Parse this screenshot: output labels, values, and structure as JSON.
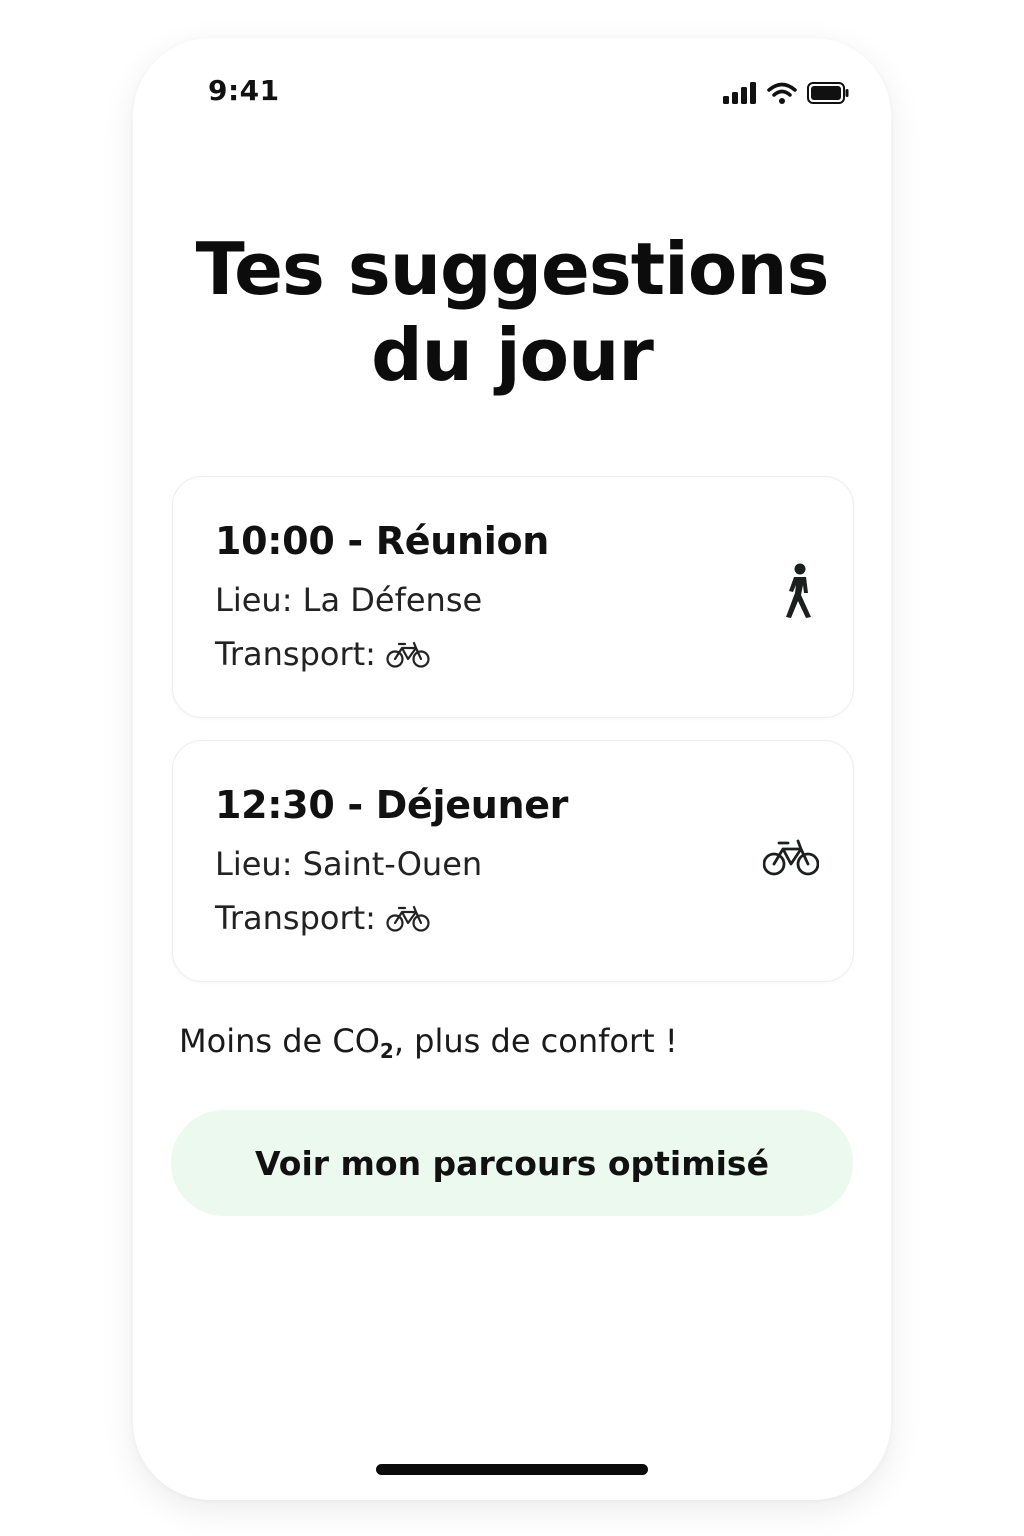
{
  "status_bar": {
    "time": "9:41",
    "icons": [
      "signal-icon",
      "wifi-icon",
      "battery-icon"
    ]
  },
  "header": {
    "title_line1": "Tes suggestions",
    "title_line2": "du jour"
  },
  "suggestions": [
    {
      "title": "10:00 - Réunion",
      "place": "Lieu: La Défense",
      "transport_label": "Transport:",
      "transport_icon": "bicycle-icon",
      "mode_icon": "walking-person-icon"
    },
    {
      "title": "12:30 - Déjeuner",
      "place": "Lieu: Saint-Ouen",
      "transport_label": "Transport:",
      "transport_icon": "bicycle-icon",
      "mode_icon": "bicycle-icon"
    }
  ],
  "tagline": {
    "before": "Moins de CO",
    "subscript": "2",
    "after": ", plus de confort !"
  },
  "cta": {
    "label": "Voir mon parcours optimisé",
    "background": "#ebf9ee"
  }
}
